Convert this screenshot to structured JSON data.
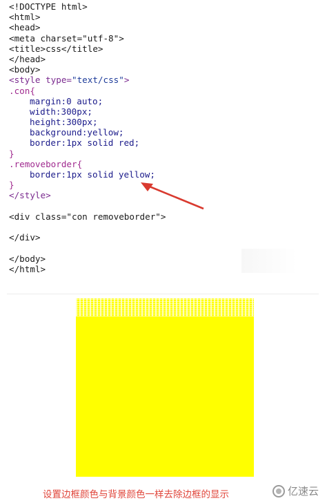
{
  "code_lines": {
    "l1": "<!DOCTYPE html>",
    "l2": "<html>",
    "l3": "<head>",
    "l4": "<meta charset=\"utf-8\">",
    "l5": "<title>css</title>",
    "l6": "</head>",
    "l7": "<body>",
    "l8_tag": "<style ",
    "l8_attr": "type=",
    "l8_val": "\"text/css\"",
    "l8_end": ">",
    "l9": ".con{",
    "l10": "margin:0 auto;",
    "l11": "width:300px;",
    "l12": "height:300px;",
    "l13": "background:yellow;",
    "l14": "border:1px solid red;",
    "l15": "}",
    "l16": ".removeborder{",
    "l17": "border:1px solid yellow;",
    "l18": "}",
    "l19": "</style>",
    "l21": "<div class=\"con removeborder\">",
    "l23": "</div>",
    "l25": "</body>",
    "l26": "</html>"
  },
  "demo": {
    "box_color": "#ffff00"
  },
  "caption": "设置边框颜色与背景颜色一样去除边框的显示",
  "watermark": {
    "text": "亿速云",
    "icon": "yisu-logo-icon"
  },
  "colors": {
    "arrow": "#d93a2f",
    "caption": "#e0453a"
  }
}
